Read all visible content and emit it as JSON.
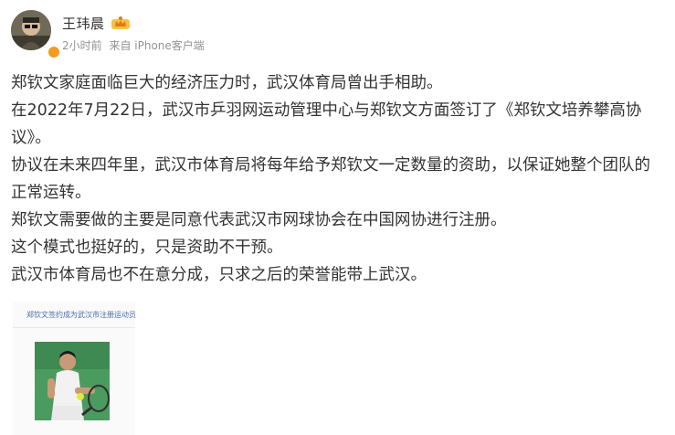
{
  "post": {
    "author": {
      "name": "王玮晨",
      "avatar_icon": "avatar-photo",
      "verified_badge_color": "#f29b1d",
      "member_crown_icon": "crown-icon"
    },
    "time": "2小时前",
    "source": "来自 iPhone客户端",
    "paragraphs": [
      "郑钦文家庭面临巨大的经济压力时，武汉体育局曾出手相助。",
      "在2022年7月22日，武汉市乒羽网运动管理中心与郑钦文方面签订了《郑钦文培养攀高协议》。",
      "协议在未来四年里，武汉市体育局将每年给予郑钦文一定数量的资助，以保证她整个团队的正常运转。",
      "郑钦文需要做的主要是同意代表武汉市网球协会在中国网协进行注册。",
      "这个模式也挺好的，只是资助不干预。",
      "武汉市体育局也不在意分成，只求之后的荣誉能带上武汉。"
    ],
    "attachment": {
      "title": "郑钦文签约成为武汉市注册运动员",
      "photo_icon": "tennis-player-photo"
    }
  }
}
